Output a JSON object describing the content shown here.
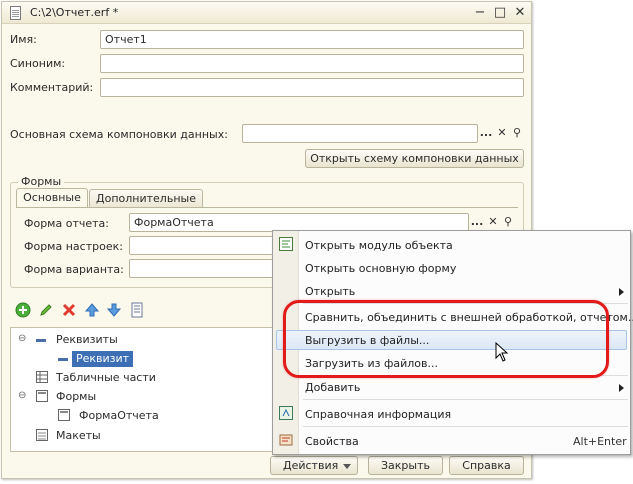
{
  "window": {
    "title": "C:\\2\\Отчет.erf *",
    "min": "−",
    "max": "□",
    "close": "✕"
  },
  "form": {
    "name_label": "Имя:",
    "name_value": "Отчет1",
    "synonym_label": "Синоним:",
    "synonym_value": "",
    "comment_label": "Комментарий:",
    "comment_value": "",
    "schema_label": "Основная схема компоновки данных:",
    "schema_value": "",
    "schema_button": "Открыть схему компоновки данных",
    "dots": "...",
    "clear": "✕",
    "search": "⚲"
  },
  "forms_group": {
    "title": "Формы",
    "tabs": [
      "Основные",
      "Дополнительные"
    ],
    "report_form_label": "Форма отчета:",
    "report_form_value": "ФормаОтчета",
    "settings_form_label": "Форма настроек:",
    "settings_form_value": "",
    "variant_form_label": "Форма варианта:",
    "variant_form_value": ""
  },
  "toolbar": {
    "add_icon": "plus-circle-icon",
    "edit_icon": "pencil-icon",
    "delete_icon": "red-x-icon",
    "up_icon": "arrow-up-icon",
    "down_icon": "arrow-down-icon",
    "list_icon": "list-icon"
  },
  "tree": {
    "requisites": "Реквизиты",
    "requisite": "Реквизит",
    "tabular": "Табличные части",
    "forms": "Формы",
    "form_item": "ФормаОтчета",
    "layouts": "Макеты",
    "expand_open": "⊖"
  },
  "buttons": {
    "actions": "Действия",
    "close": "Закрыть",
    "help": "Справка"
  },
  "context_menu": {
    "items": [
      {
        "label": "Открыть модуль объекта"
      },
      {
        "label": "Открыть основную форму"
      },
      {
        "label": "Открыть"
      },
      {
        "label": "Сравнить, объединить с внешней обработкой, отчетом..."
      },
      {
        "label": "Выгрузить в файлы..."
      },
      {
        "label": "Загрузить из файлов..."
      },
      {
        "label": "Добавить"
      },
      {
        "label": "Справочная информация"
      },
      {
        "label": "Свойства",
        "shortcut": "Alt+Enter"
      }
    ],
    "highlighted_index": 4,
    "highlight_color": "#e21a1a"
  }
}
